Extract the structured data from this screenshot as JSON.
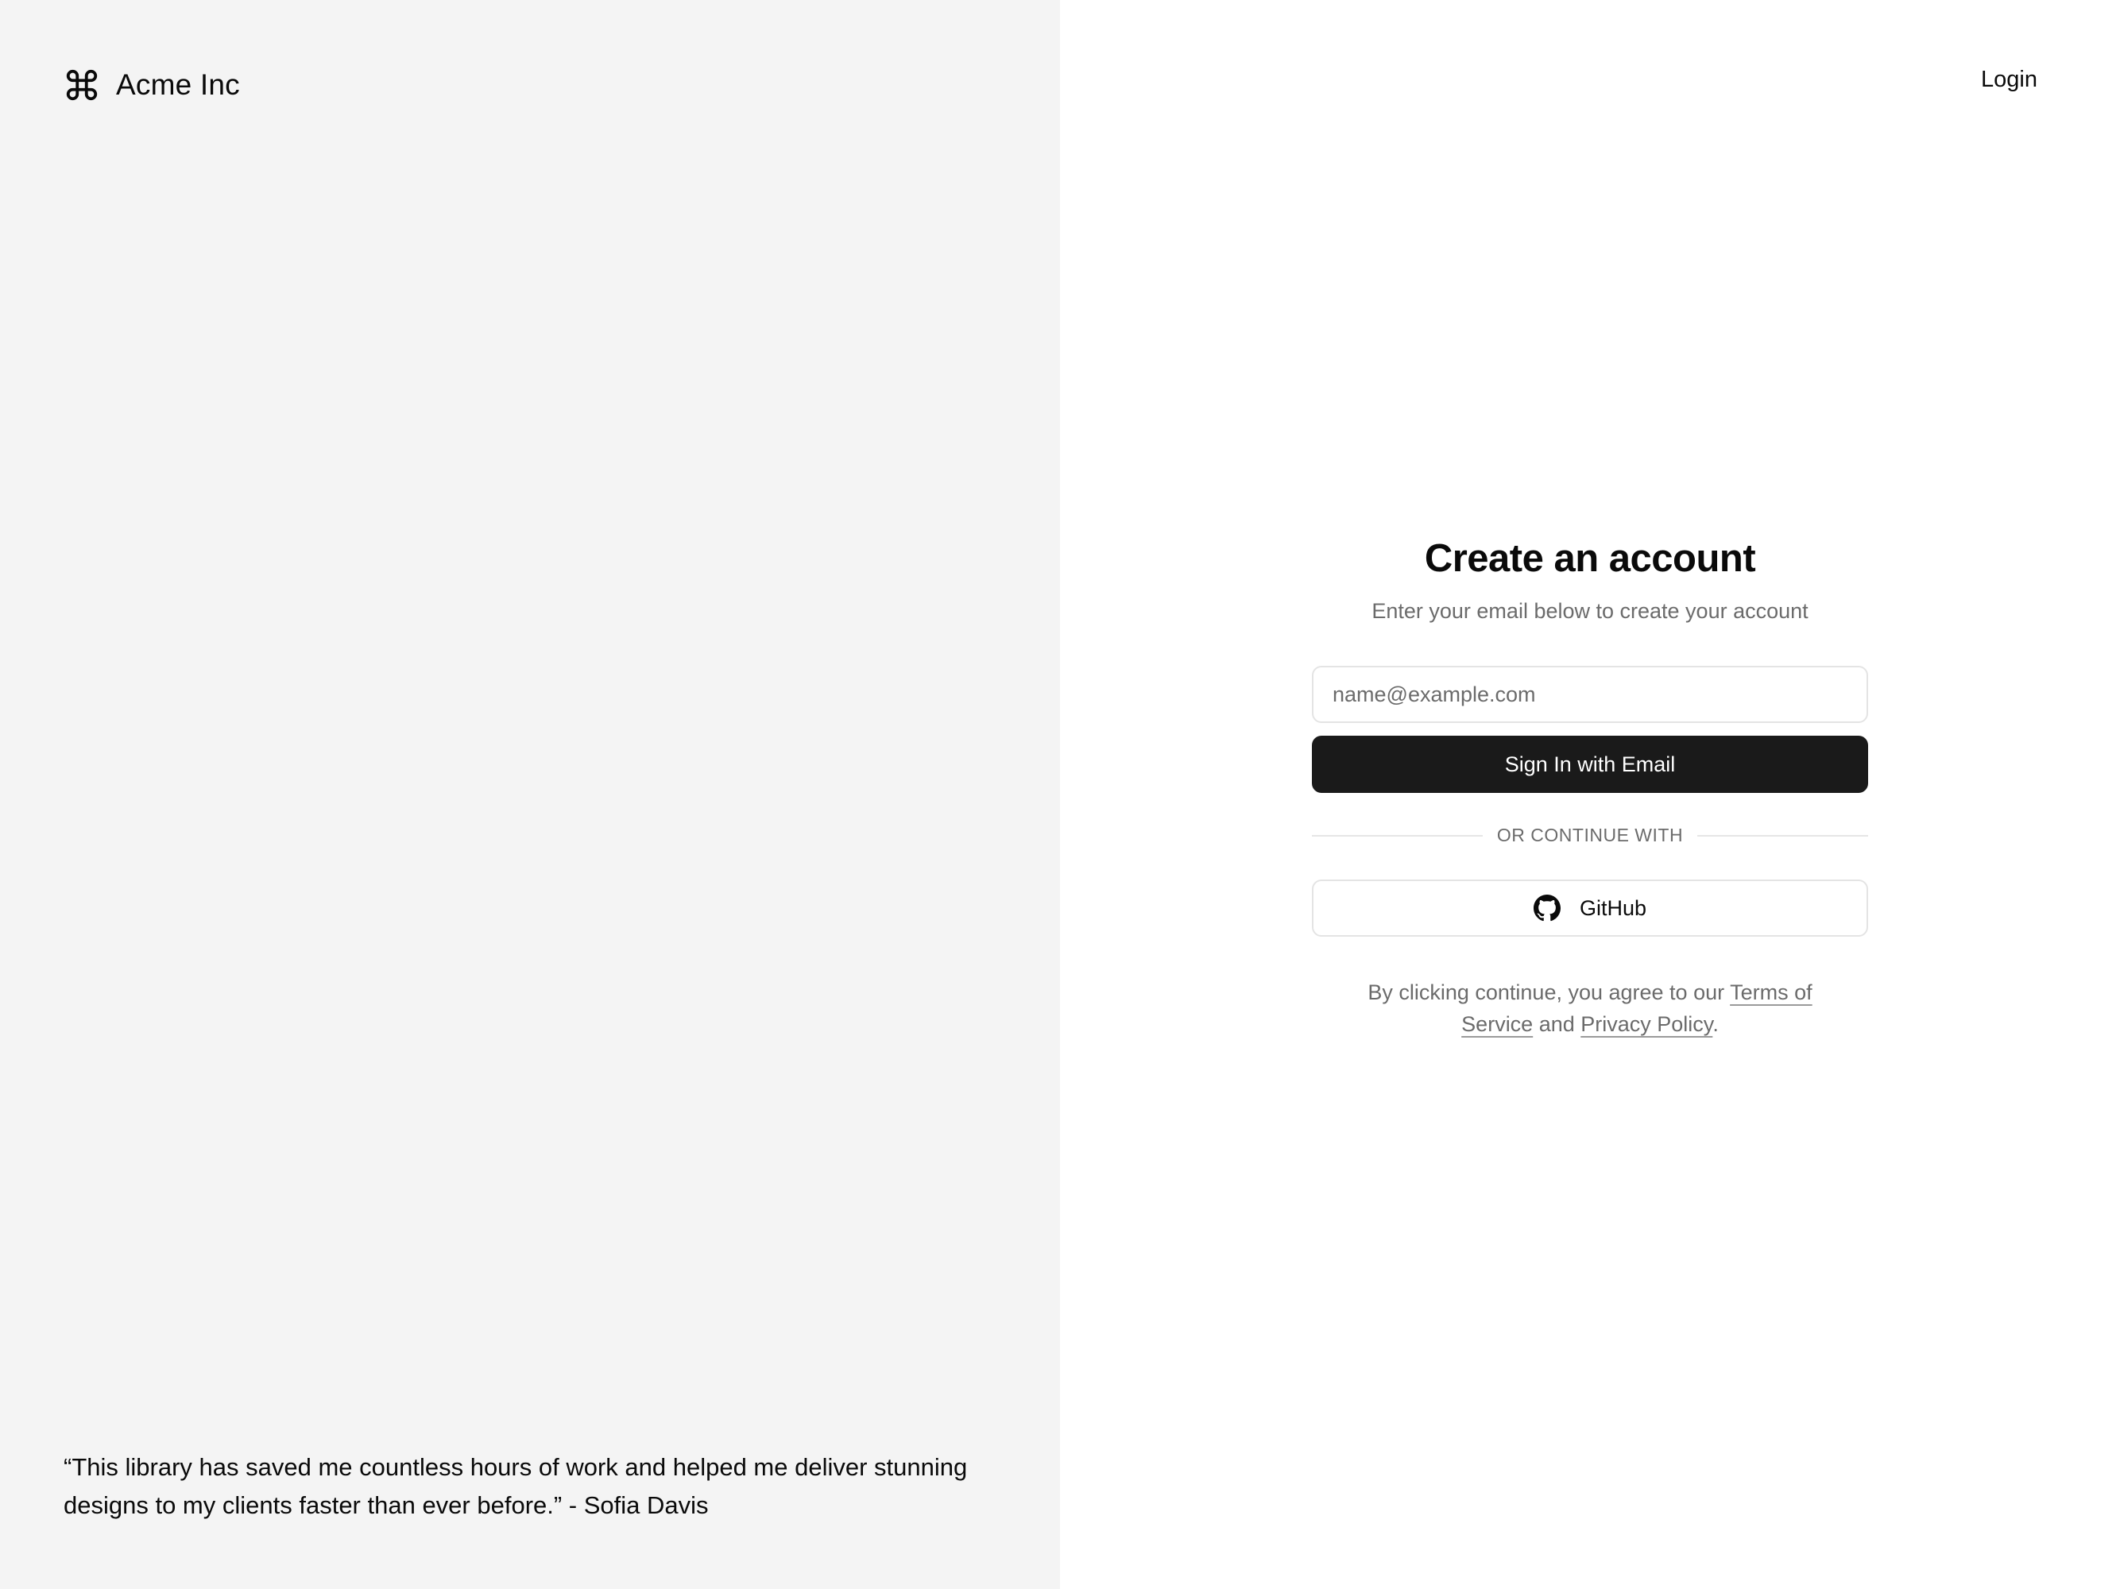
{
  "brand": {
    "name": "Acme Inc",
    "icon": "command-icon"
  },
  "testimonial": {
    "quote": "“This library has saved me countless hours of work and helped me deliver stunning designs to my clients faster than ever before.” - Sofia Davis"
  },
  "header": {
    "login_label": "Login"
  },
  "form": {
    "title": "Create an account",
    "subtitle": "Enter your email below to create your account",
    "email_placeholder": "name@example.com",
    "email_value": "",
    "submit_label": "Sign In with Email",
    "divider_label": "OR CONTINUE WITH",
    "github_label": "GitHub",
    "github_icon": "github-icon"
  },
  "legal": {
    "prefix": "By clicking continue, you agree to our ",
    "terms_label": "Terms of Service",
    "middle": " and ",
    "privacy_label": "Privacy Policy",
    "suffix": "."
  },
  "colors": {
    "left_panel_bg": "#f4f4f4",
    "primary_button_bg": "#1a1a1a",
    "muted_text": "#6b6b6b",
    "border": "#e4e4e4"
  }
}
